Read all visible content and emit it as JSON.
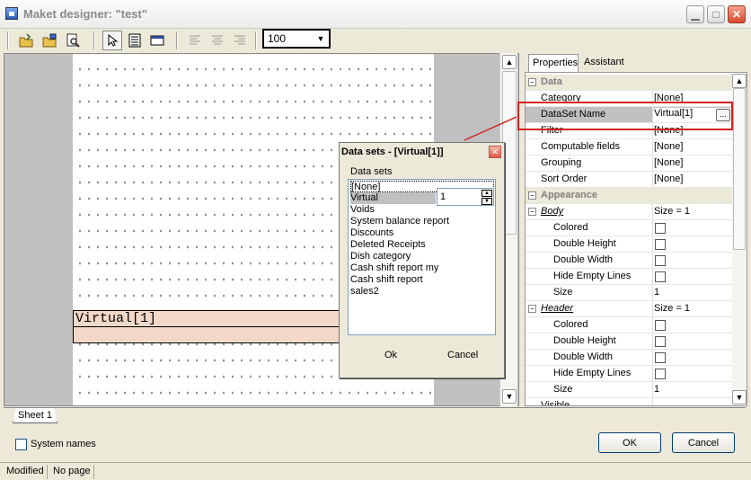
{
  "window": {
    "title": "Maket designer: \"test\"",
    "min_icon": "minimize-icon",
    "max_icon": "maximize-icon",
    "close_icon": "close-icon"
  },
  "toolbar": {
    "buttons": [
      "open-folder-icon",
      "save-folder-icon",
      "print-preview-icon",
      "pointer-icon",
      "band-icon",
      "frame-icon",
      "align-left-icon",
      "align-center-icon",
      "align-right-icon"
    ],
    "zoom_value": "100"
  },
  "canvas": {
    "band_label": "Virtual[1]"
  },
  "sheet_tab": "Sheet 1",
  "datasets_dialog": {
    "title": "Data sets - [Virtual[1]]",
    "group_label": "Data sets",
    "items": [
      "[None]",
      "Virtual",
      "Voids",
      "System balance report",
      "Discounts",
      "Deleted Receipts",
      "Dish category",
      "Cash shift report my",
      "Cash shift report",
      "sales2"
    ],
    "spin_value": "1",
    "ok_label": "Ok",
    "cancel_label": "Cancel"
  },
  "properties": {
    "tabs": [
      "Properties",
      "Assistant"
    ],
    "rows": [
      {
        "kind": "cat",
        "name": "Data"
      },
      {
        "kind": "prop",
        "name": "Category",
        "value": "[None]"
      },
      {
        "kind": "prop",
        "name": "DataSet Name",
        "value": "Virtual[1]"
      },
      {
        "kind": "prop",
        "name": "Filter",
        "value": "[None]"
      },
      {
        "kind": "prop",
        "name": "Computable fields",
        "value": "[None]"
      },
      {
        "kind": "prop",
        "name": "Grouping",
        "value": "[None]"
      },
      {
        "kind": "prop",
        "name": "Sort Order",
        "value": "[None]"
      },
      {
        "kind": "cat",
        "name": "Appearance"
      },
      {
        "kind": "sub",
        "name": "Body",
        "value": "Size = 1"
      },
      {
        "kind": "check",
        "name": "Colored"
      },
      {
        "kind": "check",
        "name": "Double Height"
      },
      {
        "kind": "check",
        "name": "Double Width"
      },
      {
        "kind": "check",
        "name": "Hide Empty Lines"
      },
      {
        "kind": "sub-prop",
        "name": "Size",
        "value": "1"
      },
      {
        "kind": "sub",
        "name": "Header",
        "value": "Size = 1"
      },
      {
        "kind": "check",
        "name": "Colored"
      },
      {
        "kind": "check",
        "name": "Double Height"
      },
      {
        "kind": "check",
        "name": "Double Width"
      },
      {
        "kind": "check",
        "name": "Hide Empty Lines"
      },
      {
        "kind": "sub-prop",
        "name": "Size",
        "value": "1"
      },
      {
        "kind": "prop",
        "name": "Visible",
        "value": ""
      }
    ]
  },
  "bottom": {
    "system_names_label": "System names",
    "ok_label": "OK",
    "cancel_label": "Cancel"
  },
  "status": {
    "modified": "Modified",
    "page": "No page"
  },
  "colors": {
    "band_fill": "#f2d8c9",
    "highlight": "#d42020",
    "title_text": "#8a8a8a"
  }
}
